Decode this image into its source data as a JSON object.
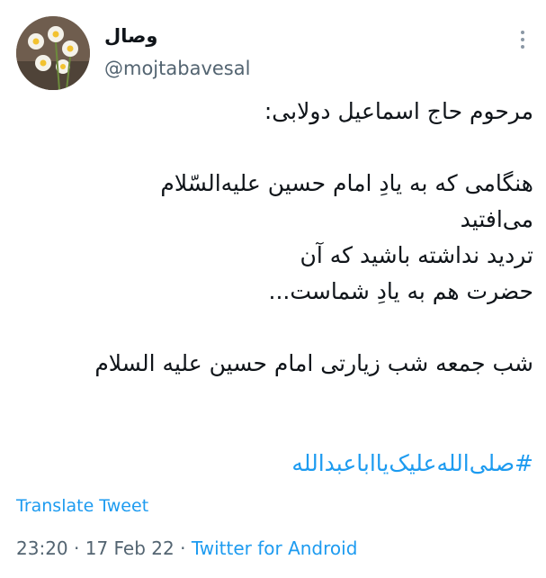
{
  "author": {
    "display_name": "وصال",
    "handle": "@mojtabavesal"
  },
  "tweet": {
    "lines": [
      "مرحوم حاج اسماعیل دولابی:",
      "",
      "هنگامی که به یادِ امام حسین علیه‌السّلام",
      "می‌افتید",
      "تردید نداشته باشید که آن",
      "حضرت هم به یادِ شماست...",
      "",
      "شب جمعه شب زیارتی امام حسین علیه السلام"
    ],
    "hashtag": "#صلی‌الله‌علیک‌یااباعبدالله"
  },
  "translate_label": "Translate Tweet",
  "meta": {
    "time": "23:20",
    "separator": " · ",
    "date": "17 Feb 22",
    "source": "Twitter for Android"
  },
  "colors": {
    "link": "#1d9bf0",
    "text": "#0f1419",
    "secondary": "#536471"
  }
}
